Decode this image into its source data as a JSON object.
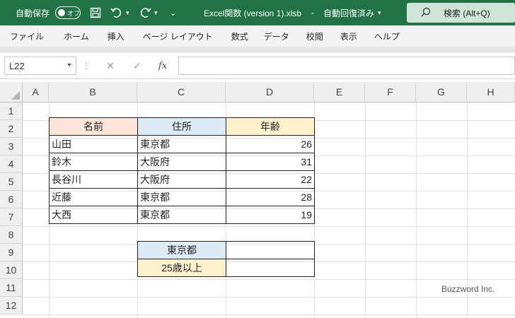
{
  "titlebar": {
    "autosave_label": "自動保存",
    "autosave_toggle": "オフ",
    "save_icon": "save-icon",
    "undo_icon": "undo-icon",
    "redo_icon": "redo-icon",
    "filename": "Excel関数 (version 1).xlsb",
    "save_status": "自動回復済み",
    "search_placeholder": "検索 (Alt+Q)",
    "accent_color": "#217346"
  },
  "ribbon": {
    "tabs": [
      "ファイル",
      "ホーム",
      "挿入",
      "ページ レイアウト",
      "数式",
      "データ",
      "校閲",
      "表示",
      "ヘルプ"
    ]
  },
  "formula_bar": {
    "name_box": "L22",
    "cancel_icon": "✕",
    "enter_icon": "✓",
    "fx_label": "fx",
    "formula": ""
  },
  "sheet": {
    "columns": [
      "A",
      "B",
      "C",
      "D",
      "E",
      "F",
      "G",
      "H"
    ],
    "rows": [
      "1",
      "2",
      "3",
      "4",
      "5",
      "6",
      "7",
      "8",
      "9",
      "10",
      "11",
      "12"
    ],
    "table": {
      "headers": [
        "名前",
        "住所",
        "年齢"
      ],
      "header_colors": [
        "#fce4d6",
        "#ddebf7",
        "#fff2cc"
      ],
      "rows": [
        [
          "山田",
          "東京都",
          "26"
        ],
        [
          "鈴木",
          "大阪府",
          "31"
        ],
        [
          "長谷川",
          "大阪府",
          "22"
        ],
        [
          "近藤",
          "東京都",
          "28"
        ],
        [
          "大西",
          "東京都",
          "19"
        ]
      ]
    },
    "criteria": {
      "addr_label": "東京都",
      "addr_result": "",
      "age_label": "25歳以上",
      "age_result": ""
    }
  },
  "watermark": "Buzzword Inc."
}
